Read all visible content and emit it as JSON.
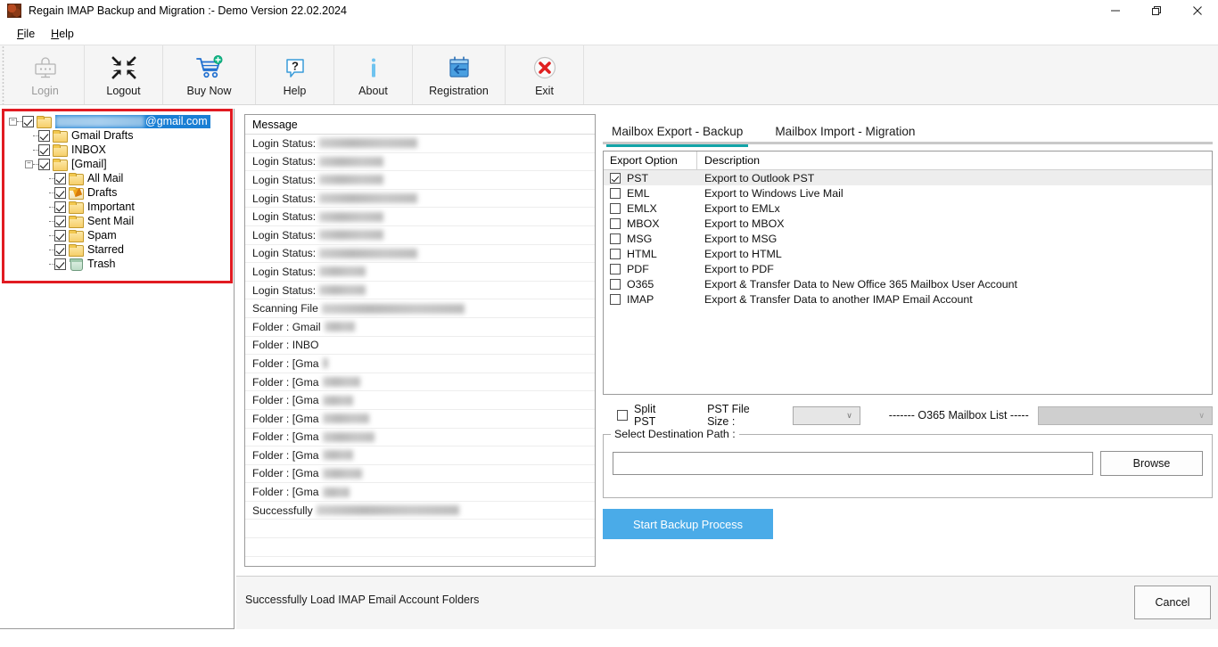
{
  "window": {
    "title": "Regain IMAP Backup and Migration :- Demo Version 22.02.2024",
    "icon": "app-icon",
    "minimize": "—",
    "maximize": "❐",
    "close": "✕"
  },
  "menu": {
    "items": [
      {
        "label": "File"
      },
      {
        "label": "Help"
      }
    ]
  },
  "toolbar": {
    "items": [
      {
        "label": "Login",
        "icon": "login-icon",
        "enabled": false
      },
      {
        "label": "Logout",
        "icon": "logout-icon",
        "enabled": true
      },
      {
        "label": "Buy Now",
        "icon": "cart-icon",
        "enabled": true
      },
      {
        "label": "Help",
        "icon": "question-icon",
        "enabled": true
      },
      {
        "label": "About",
        "icon": "info-icon",
        "enabled": true
      },
      {
        "label": "Registration",
        "icon": "registration-icon",
        "enabled": true
      },
      {
        "label": "Exit",
        "icon": "exit-icon",
        "enabled": true
      }
    ]
  },
  "tree": {
    "highlight_color": "#e11b22",
    "selection_color": "#1a7fd4",
    "root": {
      "label_suffix": "@gmail.com",
      "label_redacted": true,
      "checked": true,
      "expanded": true,
      "selected": true
    },
    "nodes": [
      {
        "label": "Gmail Drafts",
        "icon": "folder-icon",
        "checked": true,
        "depth": 1,
        "expander": false
      },
      {
        "label": "INBOX",
        "icon": "folder-icon",
        "checked": true,
        "depth": 1,
        "expander": false
      },
      {
        "label": "[Gmail]",
        "icon": "folder-icon",
        "checked": true,
        "depth": 1,
        "expander": true
      },
      {
        "label": "All Mail",
        "icon": "folder-icon",
        "checked": true,
        "depth": 2,
        "expander": false
      },
      {
        "label": "Drafts",
        "icon": "folder-draft-icon",
        "checked": true,
        "depth": 2,
        "expander": false
      },
      {
        "label": "Important",
        "icon": "folder-icon",
        "checked": true,
        "depth": 2,
        "expander": false
      },
      {
        "label": "Sent Mail",
        "icon": "folder-icon",
        "checked": true,
        "depth": 2,
        "expander": false
      },
      {
        "label": "Spam",
        "icon": "folder-icon",
        "checked": true,
        "depth": 2,
        "expander": false
      },
      {
        "label": "Starred",
        "icon": "folder-icon",
        "checked": true,
        "depth": 2,
        "expander": false
      },
      {
        "label": "Trash",
        "icon": "trash-icon",
        "checked": true,
        "depth": 2,
        "expander": false
      }
    ]
  },
  "message_panel": {
    "header": "Message",
    "rows": [
      {
        "label": "Login Status:",
        "redacted_width": 110
      },
      {
        "label": "Login Status:",
        "redacted_width": 72
      },
      {
        "label": "Login Status:",
        "redacted_width": 72
      },
      {
        "label": "Login Status:",
        "redacted_width": 110
      },
      {
        "label": "Login Status:",
        "redacted_width": 72
      },
      {
        "label": "Login Status:",
        "redacted_width": 72
      },
      {
        "label": "Login Status:",
        "redacted_width": 110
      },
      {
        "label": "Login Status:",
        "redacted_width": 52
      },
      {
        "label": "Login Status:",
        "redacted_width": 52
      },
      {
        "label": "Scanning File",
        "redacted_width": 160
      },
      {
        "label": "Folder : Gmail",
        "redacted_width": 34
      },
      {
        "label": "Folder : INBO",
        "redacted_width": 0
      },
      {
        "label": "Folder : [Gma",
        "redacted_width": 6
      },
      {
        "label": "Folder : [Gma",
        "redacted_width": 42
      },
      {
        "label": "Folder : [Gma",
        "redacted_width": 34
      },
      {
        "label": "Folder : [Gma",
        "redacted_width": 52
      },
      {
        "label": "Folder : [Gma",
        "redacted_width": 58
      },
      {
        "label": "Folder : [Gma",
        "redacted_width": 34
      },
      {
        "label": "Folder : [Gma",
        "redacted_width": 44
      },
      {
        "label": "Folder : [Gma",
        "redacted_width": 30
      },
      {
        "label": "Successfully",
        "redacted_width": 160
      },
      {
        "label": "",
        "redacted_width": 0
      },
      {
        "label": "",
        "redacted_width": 0
      }
    ]
  },
  "right_panel": {
    "tabs": [
      {
        "label": "Mailbox Export - Backup",
        "active": true
      },
      {
        "label": "Mailbox Import - Migration",
        "active": false
      }
    ],
    "active_tab_underline_color": "#12a4a8",
    "table": {
      "columns": [
        "Export Option",
        "Description"
      ],
      "rows": [
        {
          "option": "PST",
          "description": "Export to Outlook PST",
          "checked": true,
          "selected": true
        },
        {
          "option": "EML",
          "description": "Export to Windows Live Mail",
          "checked": false,
          "selected": false
        },
        {
          "option": "EMLX",
          "description": "Export to EMLx",
          "checked": false,
          "selected": false
        },
        {
          "option": "MBOX",
          "description": "Export to MBOX",
          "checked": false,
          "selected": false
        },
        {
          "option": "MSG",
          "description": "Export to MSG",
          "checked": false,
          "selected": false
        },
        {
          "option": "HTML",
          "description": "Export to HTML",
          "checked": false,
          "selected": false
        },
        {
          "option": "PDF",
          "description": "Export to PDF",
          "checked": false,
          "selected": false
        },
        {
          "option": "O365",
          "description": "Export & Transfer Data to New Office 365 Mailbox User Account",
          "checked": false,
          "selected": false
        },
        {
          "option": "IMAP",
          "description": "Export & Transfer Data to another IMAP Email Account",
          "checked": false,
          "selected": false
        }
      ]
    },
    "controls": {
      "split_pst_label": "Split PST",
      "split_pst_checked": false,
      "pst_file_size_label": "PST File Size :",
      "pst_file_size_value": "",
      "o365_list_label": "------- O365 Mailbox List -----",
      "o365_list_value": "",
      "chevron": "∨"
    },
    "destination": {
      "legend": "Select Destination Path :",
      "path_value": "",
      "browse_label": "Browse"
    },
    "start_button": {
      "label": "Start Backup Process",
      "color": "#4aabe8"
    }
  },
  "status_bar": {
    "message": "Successfully Load IMAP Email Account Folders",
    "cancel_label": "Cancel"
  }
}
